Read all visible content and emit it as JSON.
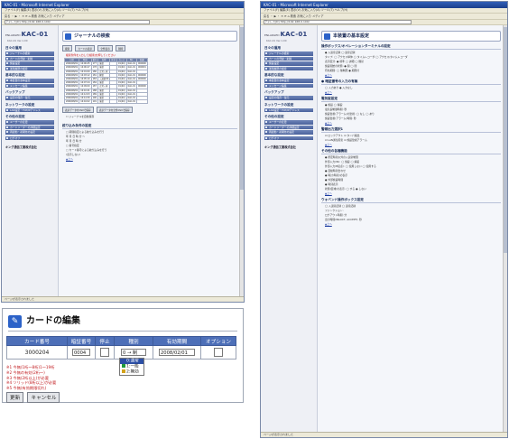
{
  "app": {
    "brand": "KAC-01",
    "brand_prefix": "ENLARGED",
    "version": "KAC-01 Ver.1.00",
    "maker": "キング通信工業株式会社",
    "browser_title": "KAC-01 - Microsoft Internet Explorer"
  },
  "menubar": "ファイル(F)  編集(E)  表示(V)  お気に入り(A)  ツール(T)  ヘルプ(H)",
  "toolbar": "戻る ・ ▶ ・ ✕  ⟳  ⌂   検索  お気に入り  メディア",
  "address": "アドレス(D)  http://192.168.0.100/",
  "status": "ページが表示されました",
  "sidebar": [
    {
      "heading": "日々の運用",
      "items": [
        "ジャーナルの検索",
        "カードの登録・削除",
        "施錠設定",
        "運用履歴の検索"
      ]
    },
    {
      "heading": "基本的な設定",
      "items": [
        "本装置の基本設定",
        "メッセージ編集"
      ]
    },
    {
      "heading": "バックアップ",
      "items": [
        "設定の保存・復元"
      ]
    },
    {
      "heading": "ネットワークの設定",
      "items": [
        "LAN設定・TCP/IPアドレス"
      ]
    },
    {
      "heading": "その他の設定",
      "items": [
        "ユーザーの変更",
        "カードリーダーの詳細設定",
        "再起動・初期化の設定"
      ]
    },
    {
      "heading": "",
      "items": [
        "ログオフ"
      ]
    }
  ],
  "win1": {
    "title": "ジャーナルの検索",
    "buttons": [
      "検索",
      "カードの表示",
      "全件表示",
      "削除"
    ],
    "note": "検索条件を入力して[検索]を押してください",
    "table_headers": [
      "日付",
      "時刻",
      "番号",
      "名称",
      "区分",
      "カード",
      "No.",
      "結果"
    ],
    "rows": [
      [
        "2006/08/01",
        "10:00:45",
        "177",
        "施錠",
        "",
        "01(40)",
        "KAC-01",
        "000000"
      ],
      [
        "2006/08/01",
        "10:00:47",
        "178",
        "施錠",
        "",
        "01(40)",
        "KAC-01",
        "000001"
      ],
      [
        "2006/08/01",
        "10:01:00",
        "180",
        "正常入室",
        "",
        "01(40)",
        "KAC-01",
        ""
      ],
      [
        "2006/08/01",
        "10:03:12",
        "181",
        "解錠",
        "",
        "01(40)",
        "KAC-01",
        "000000"
      ],
      [
        "2006/08/01",
        "10:05:10",
        "183",
        "入退室OK",
        "",
        "01(40)",
        "KAC-01",
        "000000"
      ],
      [
        "2006/08/01",
        "10:07:24",
        "184",
        "施錠",
        "",
        "01(40)",
        "KAC-01",
        ""
      ],
      [
        "2006/08/01",
        "10:09:00",
        "187",
        "正常入室",
        "",
        "01(40)",
        "KAC-01",
        "000000"
      ],
      [
        "2006/08/01",
        "10:10:41",
        "188",
        "施錠",
        "",
        "01(40)",
        "KAC-01",
        ""
      ],
      [
        "2006/08/01",
        "10:12:03",
        "189",
        "施錠",
        "",
        "01(40)",
        "KAC-01",
        ""
      ],
      [
        "2006/08/01",
        "10:14:30",
        "190",
        "施錠",
        "",
        "01(40)",
        "KAC-01",
        ""
      ],
      [
        "2006/08/01",
        "10:16:02",
        "191",
        "施錠",
        "",
        "01(40)",
        "KAC-01",
        ""
      ]
    ],
    "bottom_buttons": [
      "表示データをCSVで保存",
      "表示データを全件CSVで保存"
    ],
    "checkbox_label": "ジャーナルを自動保存",
    "section2": "絞り込み条件の設定",
    "cond_rows": [
      "□ 期間指定による絞り込みを行う",
      "年 月 日 時 分 〜",
      "年 月 日 時 分",
      "□ 番号指定",
      "",
      "□ カード番号による絞り込みを行う",
      "(表示しない)"
    ],
    "link_top": "▲上へ"
  },
  "win2": {
    "title": "本装置の基本設定",
    "sections": [
      {
        "heading": "操作ボックス/オペレーションターミナルの設定",
        "rows": [
          "● 入退室記録  ◯ 退室記録",
          "タイプ:  ◯ アクセス単体  ◯ タイムレコーダ  ◯ アクセス/タイムレコーダ",
          "表示区分:  ● 標準  ◯ 詳細  ◯ 簡易",
          "施錠開始の状態:  ● 開  ◯ 閉",
          "有効期間: ◯ 無制限  ● 期限付"
        ]
      },
      {
        "heading": "● 暗証番号の入力の有無",
        "rows": [
          "◯ 入力あり   ● 入力なし"
        ]
      },
      {
        "heading": "電気錠設定",
        "rows": [
          "● 施錠  ◯ 解錠",
          "電気錠制御時間:  秒",
          "施錠監視(アラーム)の監視:  ◯ なし  ◯ あり",
          "施錠監視(アラーム)時間:  秒"
        ]
      },
      {
        "heading": "警報出力選択1",
        "rows": [
          "☑ ロックアウト    ☑ タンパ検出",
          "☑ LAN通信障害    ☑ 施錠監視アラーム"
        ]
      },
      {
        "heading": "その他の各種機能",
        "rows": [
          "● 所定時刻以外の入退室制限",
          "外部入力(IN):  ◯ 施錠  ◯ 解錠",
          "外部入力(B接点):  ◯ 使用しない  ◯ 使用する",
          "● 自動時刻合わせ",
          "● 時計(時刻)の表示",
          "● 外部施錠時間",
          "● 時刻表示",
          "状態(区域)の表示:  ◯ する  ● しない"
        ]
      },
      {
        "heading": "ウォバンド操作ボックス設定",
        "rows": [
          "◯ 入退室記録  ◯ 退室記録",
          "ファンクション:",
          "ログアウト時間:  分",
          "出力時間(INLOCT, ACCEPT):  秒"
        ]
      }
    ],
    "link_top": "▲上へ"
  },
  "dialog": {
    "title": "カードの編集",
    "icon_glyph": "✎",
    "headers": [
      "カード番号",
      "暗証番号",
      "停止",
      "種別",
      "有効期間",
      "オプション"
    ],
    "values": {
      "card_no": "3000204",
      "pin": "0004",
      "kind": "0 → 制",
      "expiry": "2008/02/01"
    },
    "options": [
      "0:通常",
      "1:一般",
      "2:無効"
    ],
    "option_colors": [
      "#2c4fa5",
      "#1f9a3a",
      "#d3a21b"
    ],
    "notes": [
      "※1 今無(1桁～8桁)1〜19桁",
      "※2 今無の有効(2桁～)",
      "※3 今無(2桁以上)が必要",
      "※4 ソリッド(8桁以上)が必要",
      "※5 今無(有効期限切れ)"
    ],
    "buttons": [
      "更新",
      "キャンセル"
    ]
  }
}
